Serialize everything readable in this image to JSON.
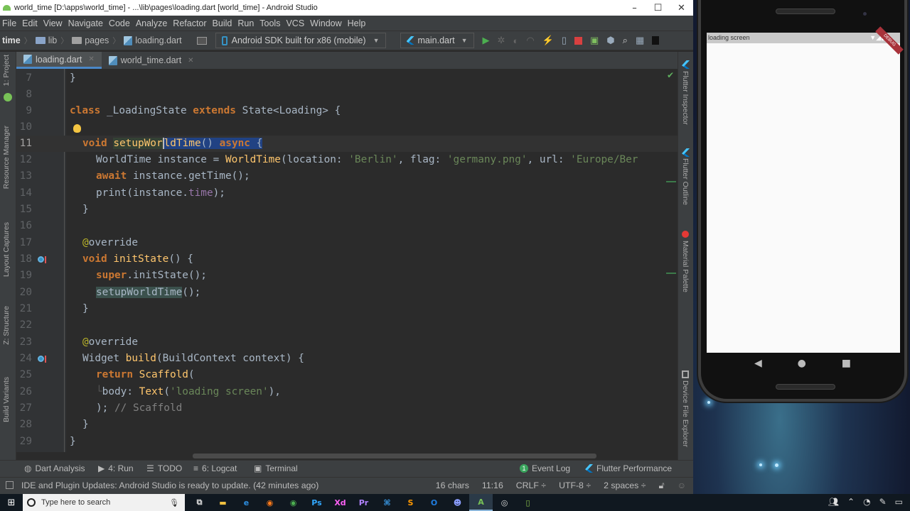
{
  "window": {
    "title": "world_time [D:\\apps\\world_time] - ...\\lib\\pages\\loading.dart [world_time] - Android Studio",
    "controls": {
      "minimize": "–",
      "maximize": "☐",
      "close": "✕"
    }
  },
  "menu": [
    "File",
    "Edit",
    "View",
    "Navigate",
    "Code",
    "Analyze",
    "Refactor",
    "Build",
    "Run",
    "Tools",
    "VCS",
    "Window",
    "Help"
  ],
  "breadcrumb": {
    "project": "time",
    "items": [
      "lib",
      "pages",
      "loading.dart"
    ]
  },
  "toolbar": {
    "device": "Android SDK built for x86 (mobile)",
    "run_config": "main.dart",
    "icons": [
      "run-icon",
      "debug-icon",
      "attach-icon",
      "profile-icon",
      "hot-reload-icon",
      "hot-restart-icon",
      "stop-icon",
      "avd-manager-icon",
      "sdk-manager-icon",
      "search-icon",
      "project-structure-icon",
      "device-icon"
    ]
  },
  "tabs": [
    {
      "label": "loading.dart",
      "active": true
    },
    {
      "label": "world_time.dart",
      "active": false
    }
  ],
  "left_tools": [
    "1: Project",
    "Resource Manager",
    "Layout Captures",
    "Z: Structure",
    "Build Variants"
  ],
  "right_tools": [
    "Flutter Inspector",
    "Flutter Outline",
    "Material Palette",
    "Device File Explorer"
  ],
  "editor": {
    "lines": [
      {
        "n": "7"
      },
      {
        "n": "8"
      },
      {
        "n": "9"
      },
      {
        "n": "10"
      },
      {
        "n": "11"
      },
      {
        "n": "12"
      },
      {
        "n": "13"
      },
      {
        "n": "14"
      },
      {
        "n": "15"
      },
      {
        "n": "16"
      },
      {
        "n": "17"
      },
      {
        "n": "18"
      },
      {
        "n": "19"
      },
      {
        "n": "20"
      },
      {
        "n": "21"
      },
      {
        "n": "22"
      },
      {
        "n": "23"
      },
      {
        "n": "24"
      },
      {
        "n": "25"
      },
      {
        "n": "26"
      },
      {
        "n": "27"
      },
      {
        "n": "28"
      },
      {
        "n": "29"
      }
    ],
    "tokens": {
      "class_kw": "class",
      "class_name": " _LoadingState ",
      "extends_kw": "extends",
      "state_type": " State<Loading> {",
      "void_kw": "void",
      "method_a": "setupWor",
      "method_b": "ldTime",
      "method_paren": "()",
      "async_kw": "async",
      "brace_open": "{",
      "l12_a": "WorldTime instance = ",
      "l12_fn": "WorldTime",
      "l12_b": "(location: ",
      "l12_s1": "'Berlin'",
      "l12_c": ", flag: ",
      "l12_s2": "'germany.png'",
      "l12_d": ", url: ",
      "l12_s3": "'Europe/Ber",
      "await_kw": "await",
      "l13_rest": " instance.getTime();",
      "l14_a": "print(instance.",
      "l14_prop": "time",
      "l14_b": ");",
      "close_brace": "}",
      "at": "@",
      "override": "override",
      "init_fn": "initState",
      "init_rest": "() {",
      "super_kw": "super",
      "super_rest": ".initState();",
      "call_setup": "setupWorldTime",
      "call_rest": "();",
      "widget": "Widget ",
      "build_fn": "build",
      "build_rest": "(BuildContext context) {",
      "return_kw": "return",
      "scaffold": "Scaffold",
      "paren_open": "(",
      "body": "body: ",
      "text_fn": "Text",
      "text_open": "(",
      "text_str": "'loading screen'",
      "text_close": "),",
      "scaffold_close": ");",
      "scaffold_comment": " // Scaffold"
    }
  },
  "bottom_tools": [
    {
      "label": "Dart Analysis",
      "icon": "dart-analysis-icon"
    },
    {
      "label": "4: Run",
      "icon": "run-icon"
    },
    {
      "label": "TODO",
      "icon": "todo-icon"
    },
    {
      "label": "6: Logcat",
      "icon": "logcat-icon"
    },
    {
      "label": "Terminal",
      "icon": "terminal-icon"
    },
    {
      "label": "Event Log",
      "badge": "1"
    },
    {
      "label": "Flutter Performance",
      "icon": "flutter-icon"
    }
  ],
  "status": {
    "message": "IDE and Plugin Updates: Android Studio is ready to update. (42 minutes ago)",
    "chars": "16 chars",
    "position": "11:16",
    "line_sep": "CRLF ÷",
    "encoding": "UTF-8 ÷",
    "indent": "2 spaces ÷"
  },
  "emulator": {
    "app_text": "loading screen",
    "debug_banner": "DEBUG",
    "nav": {
      "back": "◀",
      "home": "●",
      "recents": "■"
    }
  },
  "taskbar": {
    "search_placeholder": "Type here to search",
    "apps": [
      {
        "name": "task-view",
        "glyph": "⧉",
        "color": "#ddd"
      },
      {
        "name": "file-explorer",
        "glyph": "▬",
        "color": "#f0c040"
      },
      {
        "name": "edge",
        "glyph": "e",
        "color": "#2d8ee0"
      },
      {
        "name": "firefox",
        "glyph": "◉",
        "color": "#ff7a1a"
      },
      {
        "name": "chrome",
        "glyph": "◉",
        "color": "#4caf50"
      },
      {
        "name": "photoshop",
        "glyph": "Ps",
        "color": "#31a8ff"
      },
      {
        "name": "adobe-xd",
        "glyph": "Xd",
        "color": "#ff61f6"
      },
      {
        "name": "premiere",
        "glyph": "Pr",
        "color": "#b283ff"
      },
      {
        "name": "vscode",
        "glyph": "⌘",
        "color": "#3a9be8"
      },
      {
        "name": "sublime",
        "glyph": "S",
        "color": "#ff9800"
      },
      {
        "name": "outlook",
        "glyph": "O",
        "color": "#1f7de0"
      },
      {
        "name": "discord",
        "glyph": "☻",
        "color": "#8c9eff"
      },
      {
        "name": "android-studio",
        "glyph": "A",
        "color": "#78c257",
        "active": true
      },
      {
        "name": "obs",
        "glyph": "◎",
        "color": "#ddd"
      },
      {
        "name": "emulator",
        "glyph": "▯",
        "color": "#8bc34a"
      }
    ],
    "tray": [
      "people-icon",
      "chevron-up-icon",
      "wifi-icon",
      "pen-icon",
      "notification-icon"
    ]
  },
  "colors": {
    "keyword": "#cc7832",
    "function": "#ffc66d",
    "string": "#6a8759",
    "property": "#9876aa",
    "annotation": "#bbb529",
    "comment": "#808080",
    "selection": "#214283",
    "accent": "#4a88c7"
  }
}
